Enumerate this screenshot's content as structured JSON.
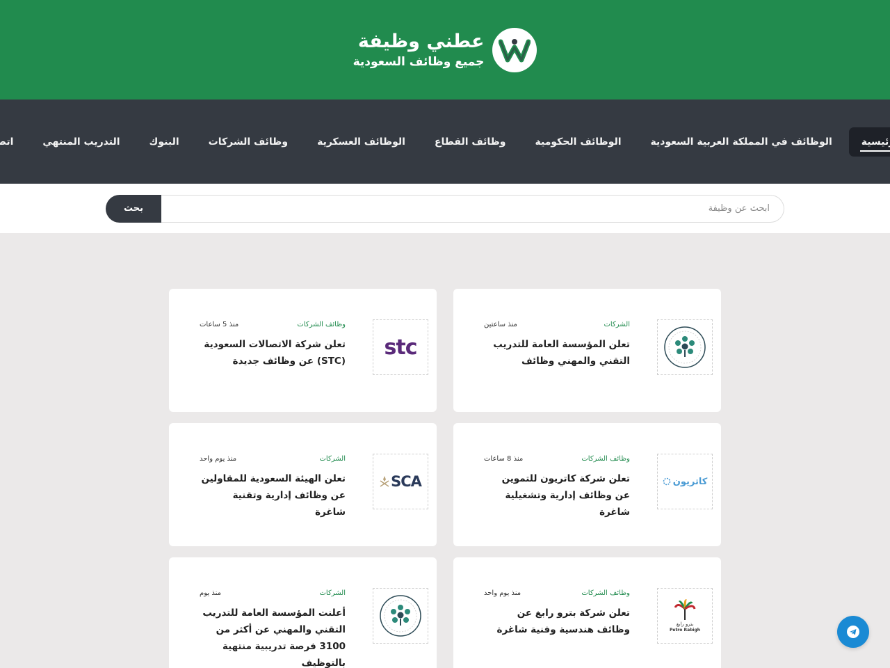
{
  "header": {
    "brand_title": "عطني وظيفة",
    "brand_subtitle": "جميع وظائف السعودية",
    "colors": {
      "brand_green": "#218b4e",
      "nav_dark": "#353a42",
      "telegram_blue": "#1a8ad4"
    }
  },
  "nav": {
    "items": [
      {
        "label": "الرئيسية",
        "active": true
      },
      {
        "label": "الوظائف في المملكة العربية السعودية",
        "active": false
      },
      {
        "label": "الوظائف الحكومية",
        "active": false
      },
      {
        "label": "وظائف القطاع",
        "active": false
      },
      {
        "label": "الوظائف العسكرية",
        "active": false
      },
      {
        "label": "وظائف الشركات",
        "active": false
      },
      {
        "label": "البنوك",
        "active": false
      },
      {
        "label": "التدريب المنتهي",
        "active": false
      },
      {
        "label": "اتصل",
        "active": false
      }
    ]
  },
  "search": {
    "placeholder": "ابحث عن وظيفة",
    "button_label": "بحث"
  },
  "cards": [
    {
      "category": "الشركات",
      "date": "منذ ساعتين",
      "title": "تعلن المؤسسة العامة للتدريب التقني والمهني وظائف",
      "logo": "tvtc-logo"
    },
    {
      "category": "وظائف الشركات",
      "date": "منذ 5 ساعات",
      "title": "تعلن شركة الاتصالات السعودية (STC) عن وظائف جديدة",
      "logo": "stc-logo"
    },
    {
      "category": "وظائف الشركات",
      "date": "منذ 8 ساعات",
      "title": "تعلن شركة كاتريون للتموين عن وظائف إدارية وتشغيلية شاغرة",
      "logo": "catrion-logo"
    },
    {
      "category": "الشركات",
      "date": "منذ يوم واحد",
      "title": "تعلن الهيئة السعودية للمقاولين عن وظائف إدارية وتقنية شاغرة",
      "logo": "sca-logo"
    },
    {
      "category": "وظائف الشركات",
      "date": "منذ يوم واحد",
      "title": "تعلن شركة بترو رابغ عن وظائف هندسية وفنية شاغرة",
      "logo": "petro-rabigh-logo"
    },
    {
      "category": "الشركات",
      "date": "منذ يوم",
      "title": "أعلنت المؤسسة العامة للتدريب التقني والمهني عن أكثر من 3100 فرصة تدريبية منتهية بالتوظيف",
      "logo": "tvtc-logo"
    }
  ],
  "logo_texts": {
    "stc": "stc",
    "sca": "SCA",
    "catrion": "كاتريون",
    "petro_ar": "بترو رابغ",
    "petro_en": "Petro Rabigh"
  }
}
